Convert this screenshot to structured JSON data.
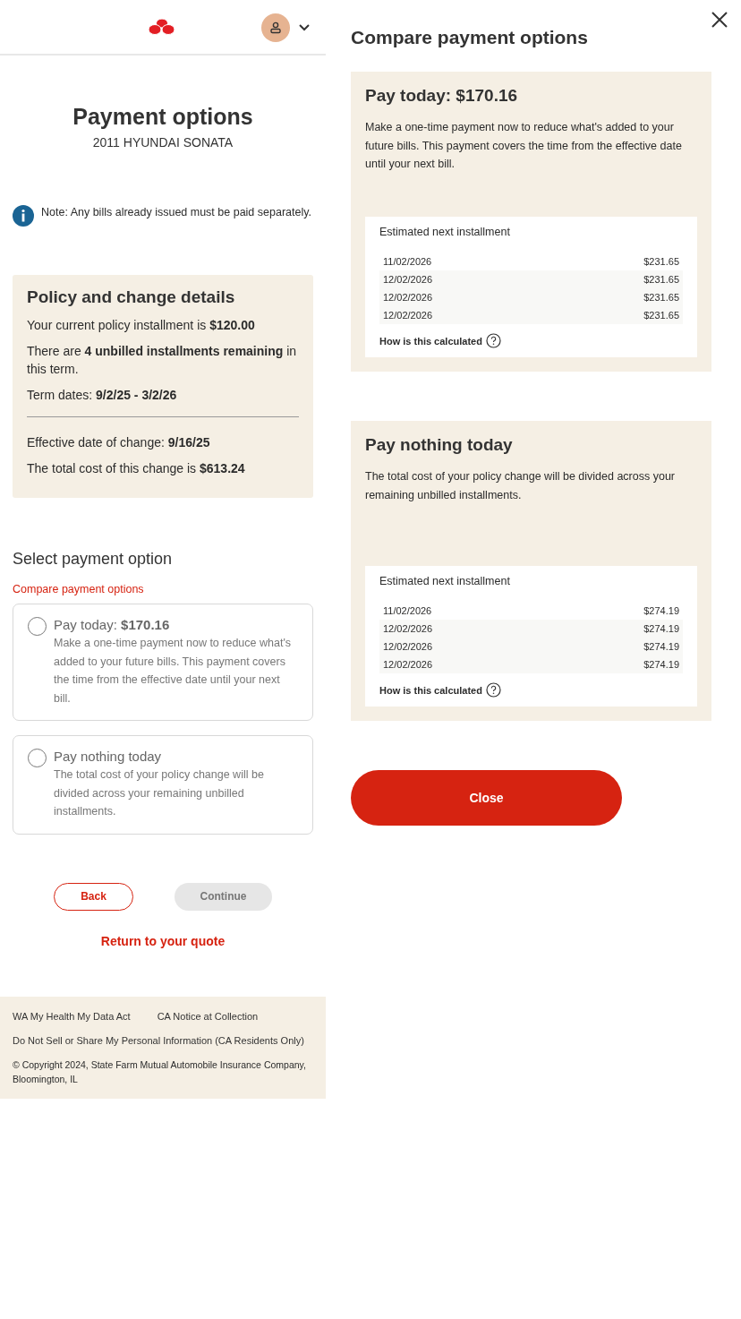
{
  "page": {
    "title": "Payment options",
    "subtitle": "2011 HYUNDAI SONATA",
    "note": "Note: Any bills already issued must be paid separately."
  },
  "details": {
    "title": "Policy and change details",
    "groups": [
      [
        "Your current policy installment is **$120.00**",
        "There are **4 unbilled installments remaining** in this term.",
        "Term dates: **9/2/25 - 3/2/26**"
      ],
      [
        "Effective date of change: **9/16/25**",
        "The total cost of this change is **$613.24**"
      ]
    ]
  },
  "selection": {
    "heading": "Select payment option",
    "compare_link": "Compare payment options",
    "options": [
      {
        "title": "Pay today: **$170.16**",
        "description": "Make a one-time payment now to reduce what's added to your future bills. This payment covers the time from the effective date until your next bill.",
        "selected": false
      },
      {
        "title": "Pay nothing today",
        "description": "The total cost of your policy change will be divided across your remaining unbilled installments.",
        "selected": false
      }
    ]
  },
  "actions": {
    "back": "Back",
    "continue": {
      "label": "Continue",
      "disabled": true
    },
    "return_link": "Return to your quote"
  },
  "footer": {
    "links": [
      "WA My Health My Data Act",
      "CA Notice at Collection",
      "Do Not Sell or Share My Personal Information (CA Residents Only)"
    ],
    "copyright": "© Copyright 2024, State Farm Mutual Automobile Insurance Company, Bloomington, IL"
  },
  "drawer": {
    "title": "Compare payment options",
    "cards": [
      {
        "title": "Pay today: $170.16",
        "description": "Make a one-time payment now to reduce what's added to your future bills. This payment covers the time from the effective date until your next bill.",
        "table": {
          "heading": "Estimated next installment",
          "rows": [
            {
              "date": "11/02/2026",
              "amount": "$231.65"
            },
            {
              "date": "12/02/2026",
              "amount": "$231.65"
            },
            {
              "date": "12/02/2026",
              "amount": "$231.65"
            },
            {
              "date": "12/02/2026",
              "amount": "$231.65"
            }
          ],
          "help": "How is this calculated"
        }
      },
      {
        "title": "Pay nothing today",
        "description": "The total cost of your policy change will be divided across your remaining unbilled installments.",
        "table": {
          "heading": "Estimated next installment",
          "rows": [
            {
              "date": "11/02/2026",
              "amount": "$274.19"
            },
            {
              "date": "12/02/2026",
              "amount": "$274.19"
            },
            {
              "date": "12/02/2026",
              "amount": "$274.19"
            },
            {
              "date": "12/02/2026",
              "amount": "$274.19"
            }
          ],
          "help": "How is this calculated"
        }
      }
    ],
    "close_button": "Close"
  }
}
